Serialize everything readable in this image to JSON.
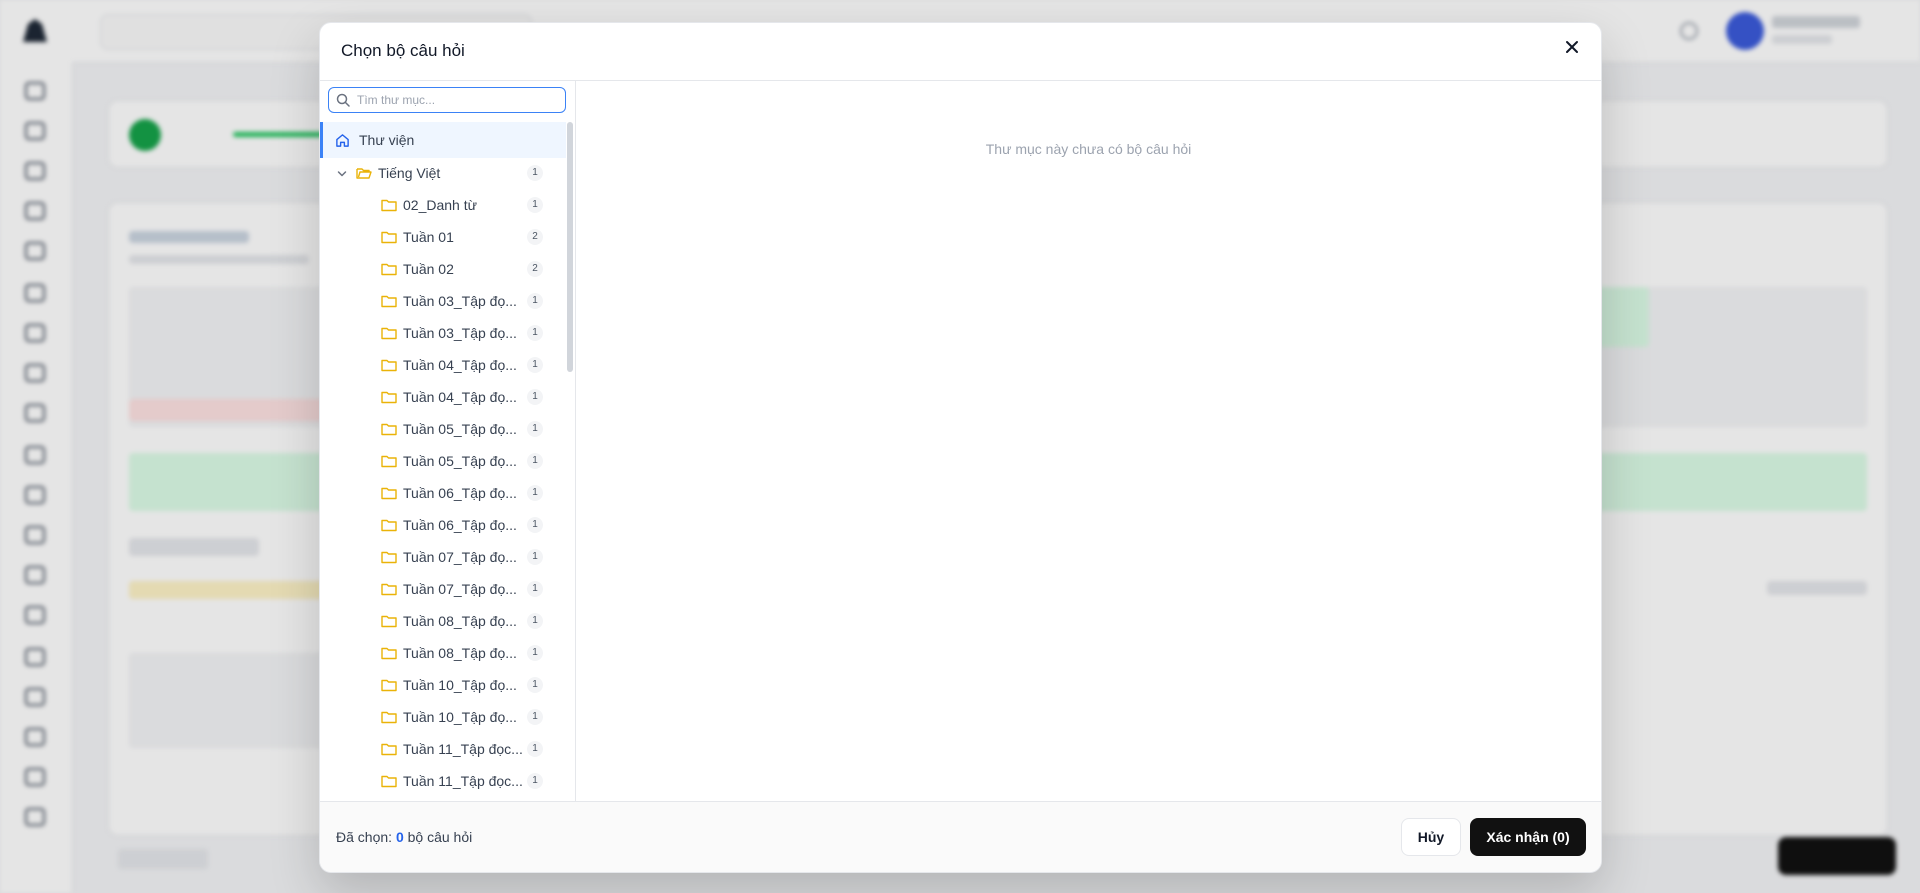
{
  "modal": {
    "title": "Chọn bộ câu hỏi",
    "search": {
      "placeholder": "Tìm thư mục...",
      "value": ""
    },
    "tree": {
      "root": {
        "label": "Thư viện"
      },
      "folder": {
        "label": "Tiếng Việt",
        "count": "1",
        "expanded": true
      },
      "children": [
        {
          "label": "02_Danh từ",
          "count": "1"
        },
        {
          "label": "Tuần 01",
          "count": "2"
        },
        {
          "label": "Tuần 02",
          "count": "2"
        },
        {
          "label": "Tuần 03_Tập đọ...",
          "count": "1"
        },
        {
          "label": "Tuần 03_Tập đọ...",
          "count": "1"
        },
        {
          "label": "Tuần 04_Tập đọ...",
          "count": "1"
        },
        {
          "label": "Tuần 04_Tập đọ...",
          "count": "1"
        },
        {
          "label": "Tuần 05_Tập đọ...",
          "count": "1"
        },
        {
          "label": "Tuần 05_Tập đọ...",
          "count": "1"
        },
        {
          "label": "Tuần 06_Tập đọ...",
          "count": "1"
        },
        {
          "label": "Tuần 06_Tập đọ...",
          "count": "1"
        },
        {
          "label": "Tuần 07_Tập đọ...",
          "count": "1"
        },
        {
          "label": "Tuần 07_Tập đọ...",
          "count": "1"
        },
        {
          "label": "Tuần 08_Tập đọ...",
          "count": "1"
        },
        {
          "label": "Tuần 08_Tập đọ...",
          "count": "1"
        },
        {
          "label": "Tuần 10_Tập đọ...",
          "count": "1"
        },
        {
          "label": "Tuần 10_Tập đọ...",
          "count": "1"
        },
        {
          "label": "Tuần 11_Tập đọc...",
          "count": "1"
        },
        {
          "label": "Tuần 11_Tập đọc...",
          "count": "1"
        }
      ]
    },
    "empty_message": "Thư mục này chưa có bộ câu hỏi",
    "footer": {
      "selected_prefix": "Đã chọn:",
      "selected_count": "0",
      "selected_suffix": "bộ câu hỏi",
      "cancel_label": "Hủy",
      "confirm_label": "Xác nhận (0)"
    }
  },
  "colors": {
    "accent": "#3b82f6",
    "folder": "#eab308",
    "primary_button": "#111111",
    "selected_count": "#2563eb"
  },
  "icons": [
    "home-icon",
    "folder-open-icon",
    "folder-icon",
    "search-icon",
    "close-icon",
    "chevron-down-icon"
  ]
}
